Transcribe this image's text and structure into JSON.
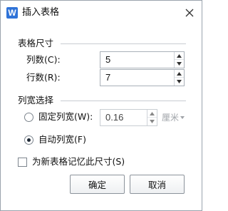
{
  "window": {
    "logo_text": "W",
    "title": "插入表格",
    "close_icon": "close-icon"
  },
  "table_size": {
    "section_title": "表格尺寸",
    "columns_label": "列数(C):",
    "columns_value": "5",
    "rows_label": "行数(R):",
    "rows_value": "7"
  },
  "column_width": {
    "section_title": "列宽选择",
    "fixed_label": "固定列宽(W):",
    "fixed_value": "0.16",
    "fixed_unit": "厘米",
    "fixed_checked": false,
    "auto_label": "自动列宽(F)",
    "auto_checked": true
  },
  "remember": {
    "label": "为新表格记忆此尺寸(S)",
    "checked": false
  },
  "buttons": {
    "ok": "确定",
    "cancel": "取消"
  },
  "colors": {
    "logo_blue": "#2f73d8",
    "border": "#9aa3ad"
  }
}
